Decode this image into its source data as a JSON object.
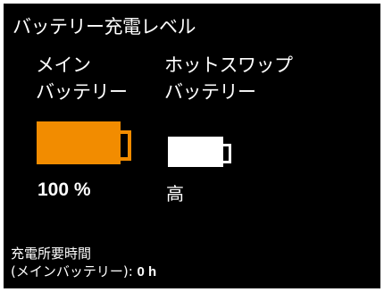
{
  "title": "バッテリー充電レベル",
  "main_battery": {
    "label_line1": "メイン",
    "label_line2": "バッテリー",
    "level_fraction": 1.0,
    "value": "100 %",
    "color": "#f28c00"
  },
  "hotswap_battery": {
    "label_line1": "ホットスワップ",
    "label_line2": "バッテリー",
    "level_fraction": 1.0,
    "value": "高",
    "color": "#ffffff"
  },
  "charge_time": {
    "label": "充電所要時間",
    "sub_label": "(メインバッテリー):",
    "value": "0 h"
  },
  "colors": {
    "background": "#000000",
    "text": "#ffffff"
  }
}
